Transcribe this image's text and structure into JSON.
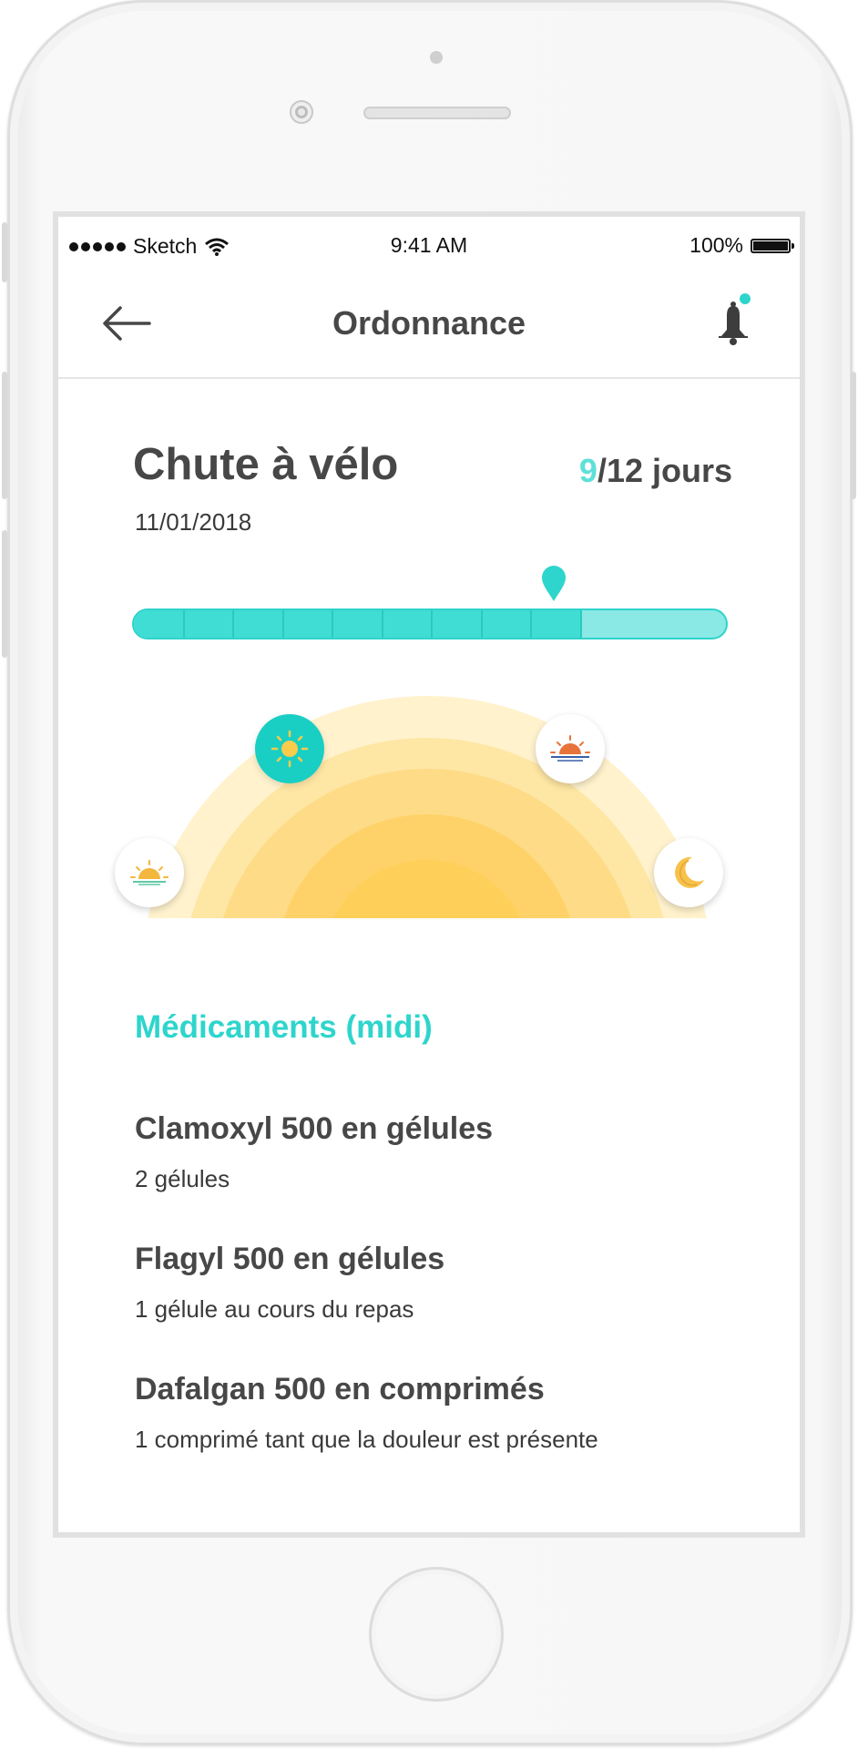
{
  "status_bar": {
    "carrier": "Sketch",
    "time": "9:41 AM",
    "battery": "100%"
  },
  "nav": {
    "title": "Ordonnance",
    "back_icon": "arrow-left-icon",
    "bell_icon": "bell-icon",
    "notification_dot_color": "#2ed5cc"
  },
  "prescription": {
    "title": "Chute à vélo",
    "date": "11/01/2018",
    "days_current": "9",
    "days_total_label": "/12 jours",
    "progress": {
      "completed": 9,
      "total": 12
    }
  },
  "times_of_day": [
    {
      "name": "morning",
      "icon": "sunrise-icon",
      "active": false
    },
    {
      "name": "midday",
      "icon": "sun-icon",
      "active": true
    },
    {
      "name": "evening",
      "icon": "sunset-icon",
      "active": false
    },
    {
      "name": "night",
      "icon": "moon-icon",
      "active": false
    }
  ],
  "medications": {
    "section_title": "Médicaments (midi)",
    "items": [
      {
        "name": "Clamoxyl 500 en gélules",
        "dose": "2 gélules"
      },
      {
        "name": "Flagyl 500 en gélules",
        "dose": "1 gélule au cours du repas"
      },
      {
        "name": "Dafalgan 500 en comprimés",
        "dose": "1 comprimé tant que la douleur est présente"
      }
    ]
  },
  "colors": {
    "accent": "#2ed5cc",
    "progress_done": "#40ddd4",
    "progress_remaining": "#8ae9e4",
    "text_dark": "#474747"
  }
}
